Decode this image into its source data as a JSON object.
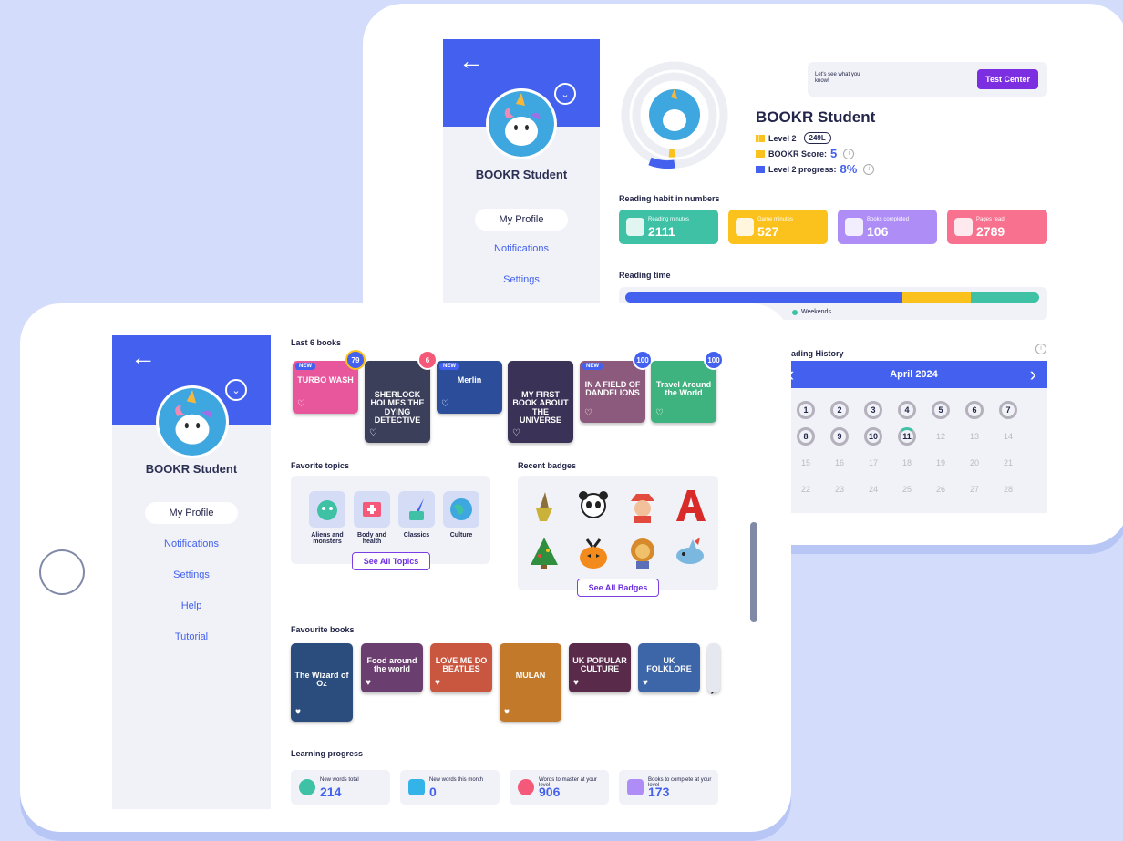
{
  "student": {
    "name": "BOOKR Student"
  },
  "nav": {
    "items": [
      "My Profile",
      "Notifications",
      "Settings",
      "Help",
      "Tutorial"
    ]
  },
  "back": {
    "glyph": "←"
  },
  "chevron": {
    "glyph": "⌄"
  },
  "test_center": {
    "prompt": "Let's see what you know!",
    "button": "Test Center"
  },
  "profile": {
    "level": "Level 2",
    "lexile": "249L",
    "score_label": "BOOKR Score:",
    "score": "5",
    "progress_label": "Level 2 progress:",
    "progress": "8%",
    "info": "i"
  },
  "habit": {
    "title": "Reading habit in numbers",
    "stats": [
      {
        "label": "Reading minutes",
        "value": "2111",
        "color": "#3ec1a4"
      },
      {
        "label": "Game minutes",
        "value": "527",
        "color": "#fbc11c"
      },
      {
        "label": "Books completed",
        "value": "106",
        "color": "#ae8df6"
      },
      {
        "label": "Pages read",
        "value": "2789",
        "color": "#f8718e"
      }
    ]
  },
  "reading_time": {
    "title": "Reading time",
    "legend_cut": "...",
    "weekends": "Weekends"
  },
  "history": {
    "title": "eading History",
    "month": "April 2024",
    "prev": "‹",
    "next": "›",
    "days": [
      "1",
      "2",
      "3",
      "4",
      "5",
      "6",
      "7",
      "8",
      "9",
      "10",
      "11",
      "12",
      "13",
      "14",
      "15",
      "16",
      "17",
      "18",
      "19",
      "20",
      "21",
      "22",
      "23",
      "24",
      "25",
      "26",
      "27",
      "28"
    ]
  },
  "last_books": {
    "title": "Last 6 books",
    "items": [
      {
        "title": "TURBO WASH",
        "tag": "NEW",
        "score": "79",
        "bg": "#e8569b"
      },
      {
        "title": "SHERLOCK HOLMES THE DYING DETECTIVE",
        "tag": "",
        "score": "6",
        "bg": "#3b3f5a"
      },
      {
        "title": "Merlin",
        "tag": "NEW",
        "score": "",
        "bg": "#2c4e9a"
      },
      {
        "title": "MY FIRST BOOK ABOUT THE UNIVERSE",
        "tag": "",
        "score": "",
        "bg": "#3a3357"
      },
      {
        "title": "IN A FIELD OF DANDELIONS",
        "tag": "NEW",
        "score": "100",
        "bg": "#8b5a7c"
      },
      {
        "title": "Travel Around the World",
        "tag": "",
        "score": "100",
        "bg": "#3fb37f"
      }
    ]
  },
  "topics": {
    "title": "Favorite topics",
    "items": [
      "Aliens and monsters",
      "Body and health",
      "Classics",
      "Culture"
    ],
    "button": "See All Topics"
  },
  "badges": {
    "title": "Recent badges",
    "button": "See All Badges"
  },
  "fav_books": {
    "title": "Favourite books",
    "items": [
      {
        "title": "The Wizard of Oz",
        "bg": "#2a4d7d"
      },
      {
        "title": "Food around the world",
        "bg": "#6a3f6f"
      },
      {
        "title": "LOVE ME DO BEATLES",
        "bg": "#c9563f"
      },
      {
        "title": "MULAN",
        "bg": "#c27a2a"
      },
      {
        "title": "UK POPULAR CULTURE",
        "bg": "#5a2a4a"
      },
      {
        "title": "UK FOLKLORE",
        "bg": "#3d66a8"
      }
    ],
    "next": "›"
  },
  "learning": {
    "title": "Learning progress",
    "items": [
      {
        "label": "New words total",
        "value": "214",
        "color": "#3ec1a4"
      },
      {
        "label": "New words this month",
        "value": "0",
        "color": "#33b3e8"
      },
      {
        "label": "Words to master at your level",
        "value": "906",
        "color": "#f5597a"
      },
      {
        "label": "Books to complete at your level",
        "value": "173",
        "color": "#ae8df6"
      }
    ]
  }
}
